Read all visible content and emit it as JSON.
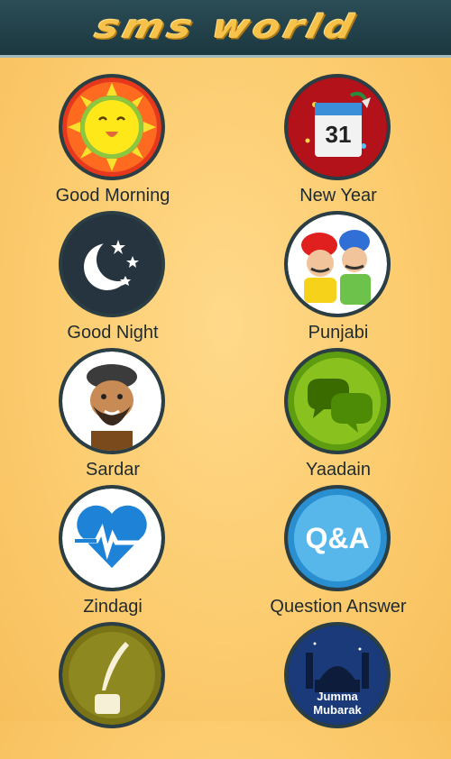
{
  "header": {
    "title": "sms world",
    "background": "#1c3840",
    "accent": "#f6c24a"
  },
  "categories": [
    {
      "label": "Good Morning",
      "icon": "sun-icon"
    },
    {
      "label": "New Year",
      "icon": "calendar-icon"
    },
    {
      "label": "Good Night",
      "icon": "moon-stars-icon"
    },
    {
      "label": "Punjabi",
      "icon": "punjabi-men-icon"
    },
    {
      "label": "Sardar",
      "icon": "sardar-face-icon"
    },
    {
      "label": "Yaadain",
      "icon": "chat-bubbles-icon"
    },
    {
      "label": "Zindagi",
      "icon": "heartbeat-icon"
    },
    {
      "label": "Question Answer",
      "icon": "qa-icon"
    },
    {
      "label": "",
      "icon": "quill-ink-icon"
    },
    {
      "label": "",
      "icon": "mosque-icon",
      "icon_text_1": "Jumma",
      "icon_text_2": "Mubarak"
    }
  ]
}
